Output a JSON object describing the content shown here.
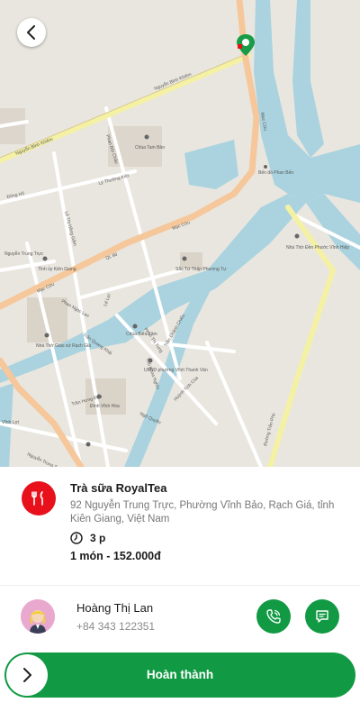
{
  "map": {
    "labels": {
      "nguyen_binh_khiem_1": "Nguyễn Bỉnh Khiêm",
      "nguyen_binh_khiem_2": "Nguyễn Bỉnh Khiêm",
      "mac_cuu_1": "Mạc Cửu",
      "mac_cuu_2": "Mạc Cửu",
      "mac_cuu_3": "Mạc Cửu",
      "phan_boi_chau": "Phan Bội Châu",
      "ly_thuong_kiet": "Lý Thường Kiệt",
      "le_thi_hong_gam": "Lê Thị Hồng Gấm",
      "ql80": "QL 80",
      "phan_ngoc_lan": "Phan Ngọc Lan",
      "le_loi": "Lê Lợi",
      "tran_quang_khai": "Trần Quang Khải",
      "phan_thi_tung": "Phan Thị Tung",
      "thu_khoa_nghia": "Thủ Khoa Nghĩa",
      "tran_chanh_chieu": "Trần Chánh Chiếu",
      "tran_hung_dao": "Trần Hưng Đạo",
      "ngo_quyen": "Ngô Quyền",
      "huynh_tinh_cua": "Huỳnh Tịnh Của",
      "dong_ho": "Đông Hồ",
      "nguyen_thuan": "Nguyễn Trung Trực",
      "chua_tam_bao": "Chùa Tam Bảo",
      "ben_do_phan_ben": "Bến đò Phan Bến",
      "nha_tho_vinh_hiep": "Nhà Thờ Đền Phước Vĩnh Hiệp",
      "nha_tho_giao_xu": "Nhà Thờ Giáo xứ Rạch Giá",
      "tinh_uy": "Tỉnh ủy Kiên Giang",
      "chua_thap_phuong": "Sắc Tứ Thập Phương Tự",
      "chua_bieu_tam": "Chùa Biểu Tâm",
      "ubnd": "UBND phường Vĩnh Thanh Vân",
      "dinh_vinh_hoa": "Đình Vĩnh Hòa",
      "nguyen_trung_truc": "Nguyễn Trung Trực",
      "vinh_loi": "Vĩnh Lợi",
      "duong_tran_phu": "Đường Trần Phú"
    }
  },
  "store": {
    "icon": "fork-knife-icon",
    "name": "Trà sữa RoyalTea",
    "address": "92 Nguyễn Trung Trực, Phường Vĩnh Bảo, Rạch Giá, tỉnh Kiên Giang, Việt Nam",
    "time": "3 p",
    "order_summary": "1 món - 152.000đ"
  },
  "driver": {
    "name": "Hoàng Thị Lan",
    "phone": "+84 343 122351"
  },
  "actions": {
    "complete_label": "Hoàn thành"
  },
  "colors": {
    "brand_green": "#119a43",
    "store_red": "#e8111b",
    "water": "#aad3df",
    "main_road": "#f5c79a",
    "secondary_road": "#f4f1a4",
    "land": "#e9e6df"
  }
}
